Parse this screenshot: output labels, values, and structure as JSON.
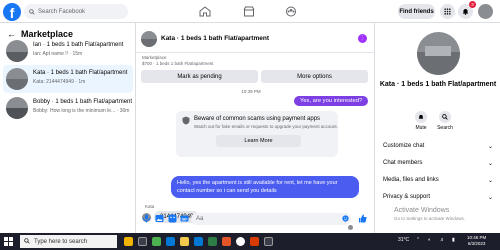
{
  "topbar": {
    "logo": "f",
    "search_placeholder": "Search Facebook",
    "find_friends": "Find friends",
    "notification_count": "3"
  },
  "left": {
    "title": "Marketplace",
    "conversations": [
      {
        "name": "Ian · 1 beds 1 bath Flat/apartment",
        "preview": "Ian: Apt name !! · 15m"
      },
      {
        "name": "Kata · 1 beds 1 bath Flat/apartment",
        "preview": "Kata: 2144474949 · 1m"
      },
      {
        "name": "Bobby · 1 beds 1 bath Flat/apartment",
        "preview": "Bobby: How long is the minimum le... · 30m"
      }
    ]
  },
  "chat": {
    "title": "Kata · 1 beds 1 bath Flat/apartment",
    "listing_label": "Marketplace",
    "listing_price": "$700 · 1 beds 1 bath Flat/apartment",
    "mark_pending": "Mark as pending",
    "more_options": "More options",
    "timestamp": "10:39 PM",
    "out_msg": "Yes, are you interested?",
    "scam_title": "Beware of common scams using payment apps",
    "scam_sub": "Watch out for fake emails or requests to upgrade your payment account.",
    "learn_more": "Learn More",
    "blue_msg": "Hello, yes the apartment is still available for rent, let me have your contact number so i can send you details",
    "in_sender": "Kata",
    "in_msg": "2144474949",
    "composer_placeholder": "Aa"
  },
  "right": {
    "name": "Kata · 1 beds 1 bath Flat/apartment",
    "mute": "Mute",
    "search": "Search",
    "rows": [
      "Customize chat",
      "Chat members",
      "Media, files and links",
      "Privacy & support"
    ],
    "watermark_title": "Activate Windows",
    "watermark_sub": "Go to Settings to activate Windows."
  },
  "taskbar": {
    "search_placeholder": "Type here to search",
    "temp": "31°C",
    "time": "10:46 PM",
    "date": "6/3/2023"
  },
  "colors": {
    "facebook_blue": "#1877f2",
    "outgoing_purple": "#7b3fe4",
    "outgoing_blue": "#4b5cf0",
    "active_bg": "#ebf5ff"
  }
}
